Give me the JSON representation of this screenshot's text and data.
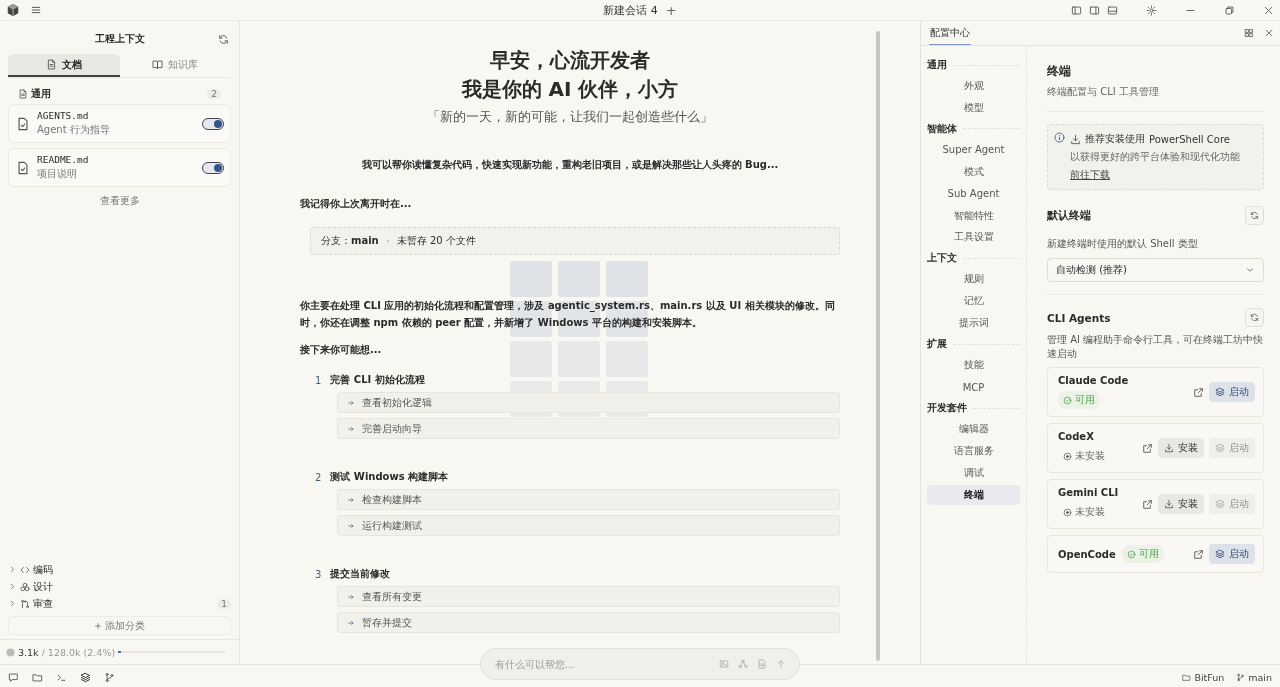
{
  "titlebar": {
    "title": "新建会话 4",
    "new_tab": "+"
  },
  "context_panel": {
    "title": "工程上下文",
    "tabs": [
      {
        "label": "文档",
        "selected": true
      },
      {
        "label": "知识库",
        "selected": false
      }
    ],
    "group": {
      "label": "通用",
      "count": "2",
      "files": [
        {
          "name": "AGENTS.md",
          "description": "Agent 行为指导",
          "on": true
        },
        {
          "name": "README.md",
          "description": "项目说明",
          "on": true
        }
      ]
    },
    "see_more": "查看更多",
    "categories": [
      {
        "label": "编码",
        "kind": "code",
        "expanded": false
      },
      {
        "label": "设计",
        "kind": "design",
        "expanded": false
      },
      {
        "label": "审查",
        "kind": "review",
        "expanded": false,
        "count": "1"
      }
    ],
    "add_category": "添加分类",
    "usage": {
      "used": "3.1k",
      "total": "/ 128.0k (2.4%)",
      "level": 0.024
    }
  },
  "main": {
    "greeting": [
      "早安，心流开发者",
      "我是你的 AI 伙伴，小方"
    ],
    "subtitle": "「新的一天，新的可能，让我们一起创造些什么」",
    "intro": "我可以帮你读懂复杂代码，快速实现新功能，重构老旧项目，或是解决那些让人头疼的 Bug...",
    "recall": "我记得你上次离开时在...",
    "branch_label": "分支：",
    "branch": "main",
    "unsaved": "未暂存 20 个文件",
    "summary": "你主要在处理 CLI 应用的初始化流程和配置管理，涉及 agentic_system.rs、main.rs 以及 UI 相关模块的修改。同时，你还在调整 npm 依赖的 peer 配置，并新增了 Windows 平台的构建和安装脚本。",
    "next": "接下来你可能想...",
    "suggestions": [
      {
        "number": "1",
        "title": "完善 CLI 初始化流程",
        "actions": [
          "查看初始化逻辑",
          "完善启动向导"
        ]
      },
      {
        "number": "2",
        "title": "测试 Windows 构建脚本",
        "actions": [
          "检查构建脚本",
          "运行构建测试"
        ]
      },
      {
        "number": "3",
        "title": "提交当前修改",
        "actions": [
          "查看所有变更",
          "暂存并提交"
        ]
      }
    ],
    "input_placeholder": "有什么可以帮您..."
  },
  "settings": {
    "tab": "配置中心",
    "nav": [
      {
        "label": "通用",
        "items": [
          {
            "label": "外观",
            "selected": false
          },
          {
            "label": "模型",
            "selected": false
          }
        ]
      },
      {
        "label": "智能体",
        "items": [
          {
            "label": "Super Agent",
            "selected": false
          },
          {
            "label": "模式",
            "selected": false
          },
          {
            "label": "Sub Agent",
            "selected": false
          },
          {
            "label": "智能特性",
            "selected": false
          },
          {
            "label": "工具设置",
            "selected": false
          }
        ]
      },
      {
        "label": "上下文",
        "items": [
          {
            "label": "规则",
            "selected": false
          },
          {
            "label": "记忆",
            "selected": false
          },
          {
            "label": "提示词",
            "selected": false
          }
        ]
      },
      {
        "label": "扩展",
        "items": [
          {
            "label": "技能",
            "selected": false
          },
          {
            "label": "MCP",
            "selected": false
          }
        ]
      },
      {
        "label": "开发套件",
        "items": [
          {
            "label": "编辑器",
            "selected": false
          },
          {
            "label": "语言服务",
            "selected": false
          },
          {
            "label": "调试",
            "selected": false
          },
          {
            "label": "终端",
            "selected": true
          }
        ]
      }
    ],
    "page": {
      "title": "终端",
      "subtitle": "终端配置与 CLI 工具管理",
      "notice": {
        "text": "推荐安装使用",
        "product": "PowerShell Core",
        "detail": "以获得更好的跨平台体验和现代化功能",
        "link": "前往下载"
      },
      "default_terminal": {
        "title": "默认终端",
        "hint": "新建终端时使用的默认 Shell 类型",
        "value": "自动检测 (推荐)"
      },
      "cli_agents": {
        "title": "CLI Agents",
        "hint": "管理 AI 编程助手命令行工具，可在终端工坊中快速启动",
        "agents": [
          {
            "name": "Claude Code",
            "status": "可用",
            "installed": true,
            "compact": false,
            "launch": "启动"
          },
          {
            "name": "CodeX",
            "status": "未安装",
            "installed": false,
            "compact": false,
            "install": "安装",
            "launch": "启动"
          },
          {
            "name": "Gemini CLI",
            "status": "未安装",
            "installed": false,
            "compact": false,
            "install": "安装",
            "launch": "启动"
          },
          {
            "name": "OpenCode",
            "status": "可用",
            "installed": true,
            "compact": true,
            "launch": "启动"
          }
        ]
      }
    }
  },
  "status_bar": {
    "app": "BitFun",
    "branch": "main"
  }
}
